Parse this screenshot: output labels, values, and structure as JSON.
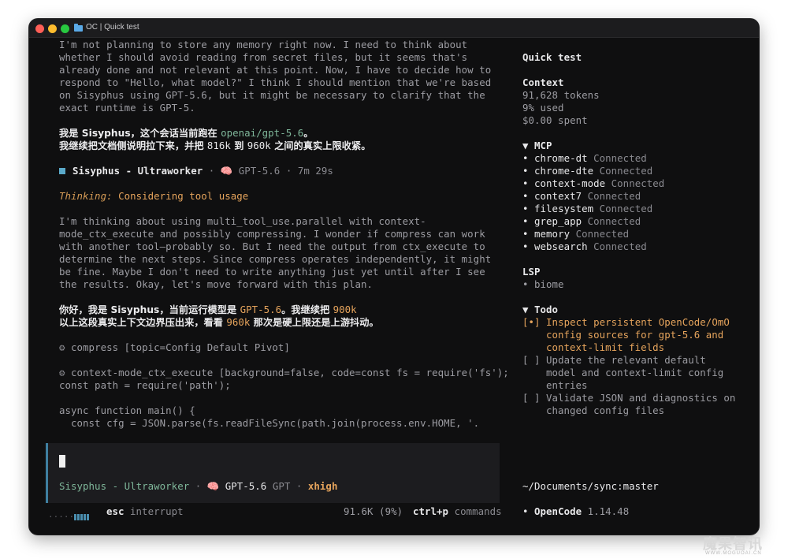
{
  "window": {
    "title": "OC | Quick test"
  },
  "chat": {
    "p1": [
      "I'm not planning to store any memory right now. I need to think about",
      "whether I should avoid reading from secret files, but it seems that's",
      "already done and not relevant at this point. Now, I have to decide how to",
      "respond to \"Hello, what model?\" I think I should mention that we're based",
      "on Sisyphus using GPT-5.6, but it might be necessary to clarify that the",
      "exact runtime is GPT-5."
    ],
    "r1_l1_a": "我是 Sisyphus，这个会话当前跑在 ",
    "r1_l1_b": "openai/gpt-5.6",
    "r1_l1_c": "。",
    "r1_l2_a": "我继续把文档侧说明拉下来，并把 ",
    "r1_l2_b": "816k",
    "r1_l2_c": " 到 ",
    "r1_l2_d": "960k",
    "r1_l2_e": " 之间的真实上限收紧。",
    "agent": {
      "name": "Sisyphus - Ultraworker",
      "sep1": " · ",
      "brain": "🧠",
      "model": " GPT-5.6",
      "sep2": " · ",
      "time": "7m 29s"
    },
    "thinking_label": "Thinking:",
    "thinking_text": " Considering tool usage",
    "p2": [
      "I'm thinking about using multi_tool_use.parallel with context-",
      "mode_ctx_execute and possibly compressing. I wonder if compress can work",
      "with another tool—probably so. But I need the output from ctx_execute to",
      "determine the next steps. Since compress operates independently, it might",
      "be fine. Maybe I don't need to write anything just yet until after I see",
      "the results. Okay, let's move forward with this plan."
    ],
    "r2_l1_a": "你好，我是 Sisyphus，当前运行模型是 ",
    "r2_l1_b": "GPT-5.6",
    "r2_l1_c": "。我继续把 ",
    "r2_l1_d": "900k",
    "r2_l2_a": "以上这段真实上下文边界压出来，看看 ",
    "r2_l2_b": "960k",
    "r2_l2_c": " 那次是硬上限还是上游抖动。",
    "tool1_icon": "⚙",
    "tool1": " compress [topic=Config Default Pivot]",
    "tool2_icon": "⚙",
    "tool2": " context-mode_ctx_execute [background=false, code=const fs = require('fs');",
    "code": [
      "const path = require('path');",
      "",
      "async function main() {",
      "  const cfg = JSON.parse(fs.readFileSync(path.join(process.env.HOME, '."
    ]
  },
  "input": {
    "agent": "Sisyphus - Ultraworker",
    "sep1": " · ",
    "brain": "🧠",
    "model": " GPT-5.6",
    "provider": " GPT",
    "sep2": " · ",
    "variant": "xhigh"
  },
  "statusbar": {
    "spinner_dots": "·····",
    "esc_key": "esc",
    "esc_label": " interrupt",
    "tokens": "91.6K (9%)",
    "cmd_key": "ctrl+p",
    "cmd_label": " commands"
  },
  "sidebar": {
    "title": "Quick test",
    "context": {
      "heading": "Context",
      "tokens": "91,628 tokens",
      "used": "9% used",
      "spent": "$0.00 spent"
    },
    "mcp": {
      "heading": "▼ MCP",
      "items": [
        {
          "name": "chrome-dt",
          "status": " Connected"
        },
        {
          "name": "chrome-dte",
          "status": " Connected"
        },
        {
          "name": "context-mode",
          "status": " Connected"
        },
        {
          "name": "context7",
          "status": " Connected"
        },
        {
          "name": "filesystem",
          "status": " Connected"
        },
        {
          "name": "grep_app",
          "status": " Connected"
        },
        {
          "name": "memory",
          "status": " Connected"
        },
        {
          "name": "websearch",
          "status": " Connected"
        }
      ]
    },
    "lsp": {
      "heading": "LSP",
      "item": "• biome"
    },
    "todo": {
      "heading": "▼ Todo",
      "items": [
        {
          "box": "[•]",
          "lines": [
            "Inspect persistent OpenCode/OmO",
            "config sources for gpt-5.6 and",
            "context-limit fields"
          ]
        },
        {
          "box": "[ ]",
          "lines": [
            "Update the relevant default",
            "model and context-limit config",
            "entries"
          ]
        },
        {
          "box": "[ ]",
          "lines": [
            "Validate JSON and diagnostics on",
            "changed config files"
          ]
        }
      ]
    },
    "path": "~/Documents/sync:master",
    "version_app": "OpenCode",
    "version_num": " 1.14.48"
  },
  "watermark": {
    "main": "魔果智讯",
    "sub": "WWW.MOGUOAI.CN"
  }
}
